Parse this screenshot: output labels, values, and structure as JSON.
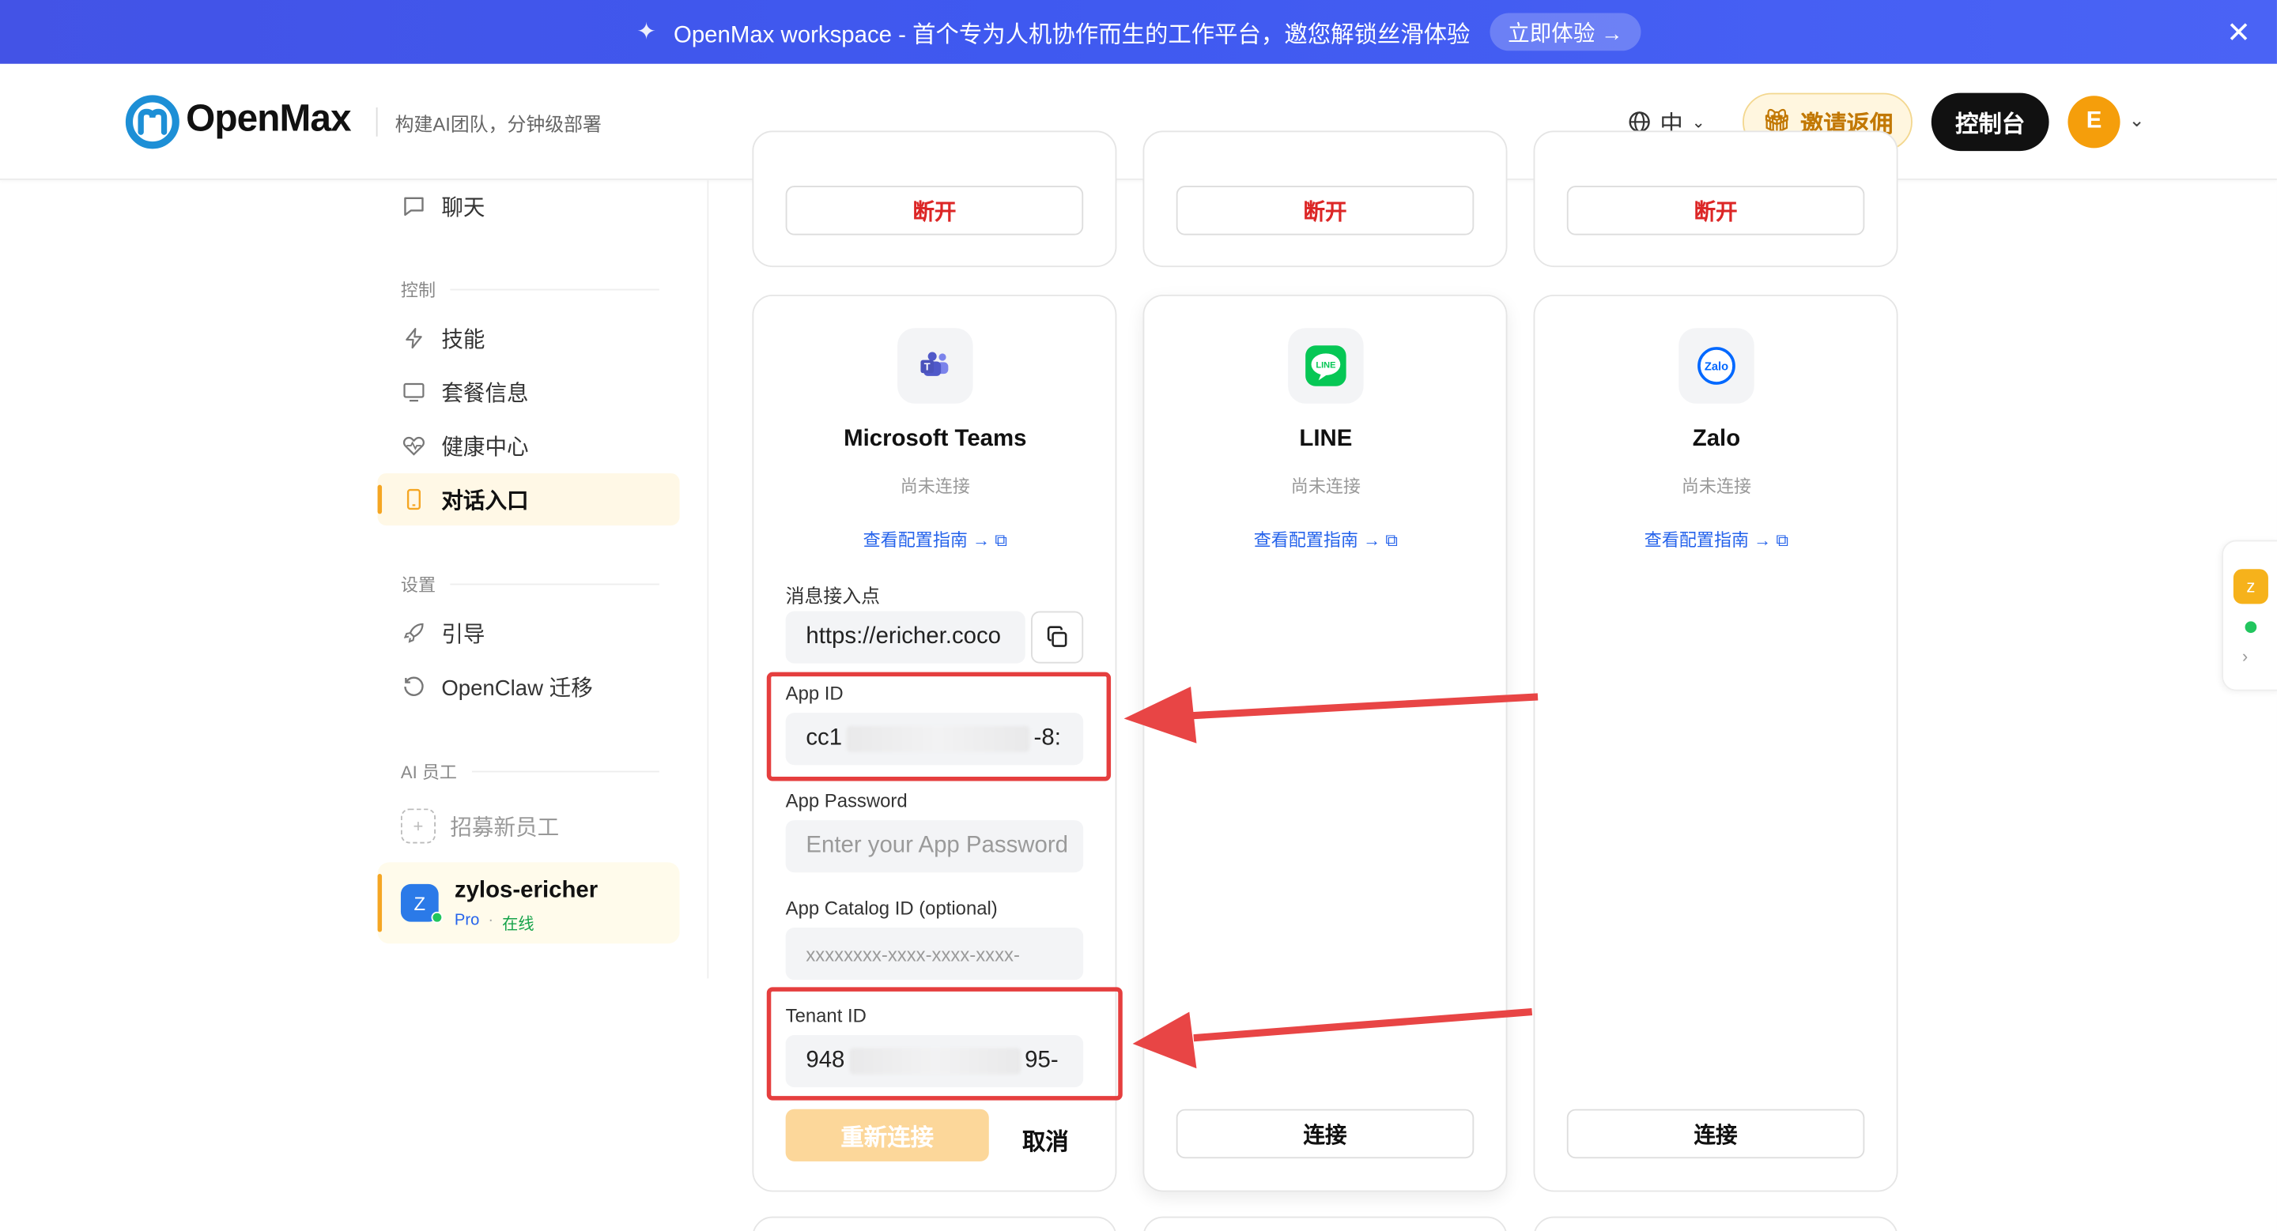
{
  "banner": {
    "text": "OpenMax workspace - 首个专为人机协作而生的工作平台，邀您解锁丝滑体验",
    "cta": "立即体验 →"
  },
  "header": {
    "logo": "OpenMax",
    "tagline": "构建AI团队，分钟级部署",
    "lang": "中",
    "invite": "邀请返佣",
    "console": "控制台",
    "avatar": "E"
  },
  "sidebar": {
    "chat": "聊天",
    "section_control": "控制",
    "skills": "技能",
    "plan": "套餐信息",
    "health": "健康中心",
    "entry": "对话入口",
    "section_settings": "设置",
    "guide": "引导",
    "migrate": "OpenClaw 迁移",
    "section_ai": "AI 员工",
    "recruit": "招募新员工",
    "employee": {
      "name": "zylos-ericher",
      "plan": "Pro",
      "dot": "·",
      "status": "在线"
    }
  },
  "cards": {
    "disconnect": "断开",
    "connect": "连接",
    "not_connected": "尚未连接",
    "guide_link": "查看配置指南 →",
    "teams": {
      "name": "Microsoft Teams",
      "endpoint_label": "消息接入点",
      "endpoint_value": "https://ericher.coco",
      "app_id_label": "App ID",
      "app_id_start": "cc1",
      "app_id_end": "-8:",
      "password_label": "App Password",
      "password_placeholder": "Enter your App Password",
      "catalog_label": "App Catalog ID (optional)",
      "catalog_placeholder": "xxxxxxxx-xxxx-xxxx-xxxx-",
      "tenant_label": "Tenant ID",
      "tenant_start": "948",
      "tenant_end": "95-",
      "reconnect": "重新连接",
      "cancel": "取消"
    },
    "line": {
      "name": "LINE"
    },
    "zalo": {
      "name": "Zalo"
    }
  },
  "mini_panel": {
    "badge": "z"
  },
  "colors": {
    "accent": "#f5a623",
    "danger": "#dc2626",
    "link": "#2563eb",
    "annotation": "#e53e3e"
  }
}
